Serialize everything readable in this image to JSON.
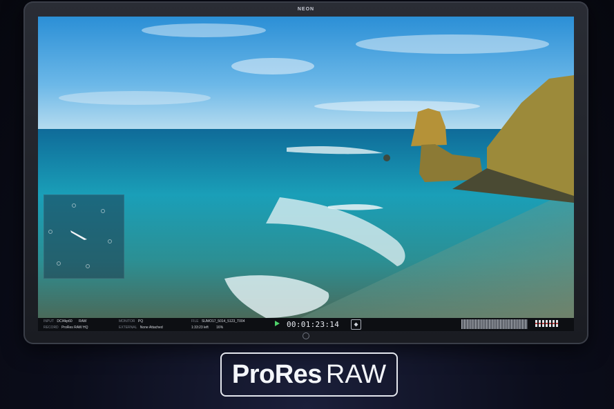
{
  "device": {
    "brand_label": "NEON"
  },
  "status_bar": {
    "input_key": "INPUT",
    "input_value": "DCI4kp60",
    "input_format": "RAW",
    "record_key": "RECORD",
    "record_value": "ProRes RAW HQ",
    "monitor_key": "MONITOR",
    "monitor_value": "PQ",
    "external_key": "EXTERNAL",
    "external_value": "None Attached",
    "file_key": "FILE",
    "file_value": "SUMO17_5014_5123_T004",
    "time_left": "1:33:23 left",
    "battery": "16%",
    "timecode": "00:01:23:14"
  },
  "badge": {
    "brand": "ProRes",
    "suffix": "RAW"
  },
  "colors": {
    "play": "#4fd36b",
    "badge_border": "#e4e7ee",
    "background": "#0b0d1b"
  },
  "icons": [
    "play-icon",
    "record-icon",
    "waveform-icon",
    "audio-meter-icon",
    "device-logo-icon"
  ]
}
